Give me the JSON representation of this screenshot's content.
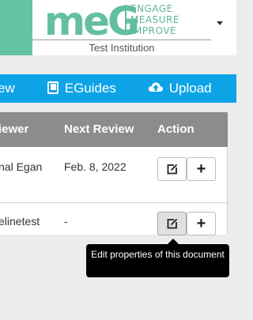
{
  "header": {
    "logo_text": "meG",
    "tagline": [
      "ENGAGE",
      "MEASURE",
      "IMPROVE"
    ],
    "institution": "Test Institution",
    "dropdown_icon": "caret-down-icon",
    "colors": {
      "bar": "#64c3a2",
      "logo": "#62bfa0"
    }
  },
  "nav": {
    "items": [
      {
        "label": "ew",
        "icon": null
      },
      {
        "label": "EGuides",
        "icon": "book-icon"
      },
      {
        "label": "Upload",
        "icon": "cloud-upload-icon"
      }
    ],
    "color": "#0ea3e6"
  },
  "table": {
    "headers": [
      "iewer",
      "Next Review",
      "Action"
    ],
    "rows": [
      {
        "reviewer": "nal Egan",
        "next_review": "Feb. 8, 2022"
      },
      {
        "reviewer": "elinetest",
        "next_review": "-"
      }
    ],
    "actions": {
      "edit_icon": "edit-icon",
      "add_label": "+"
    }
  },
  "tooltip": {
    "text": "Edit properties of this document"
  }
}
